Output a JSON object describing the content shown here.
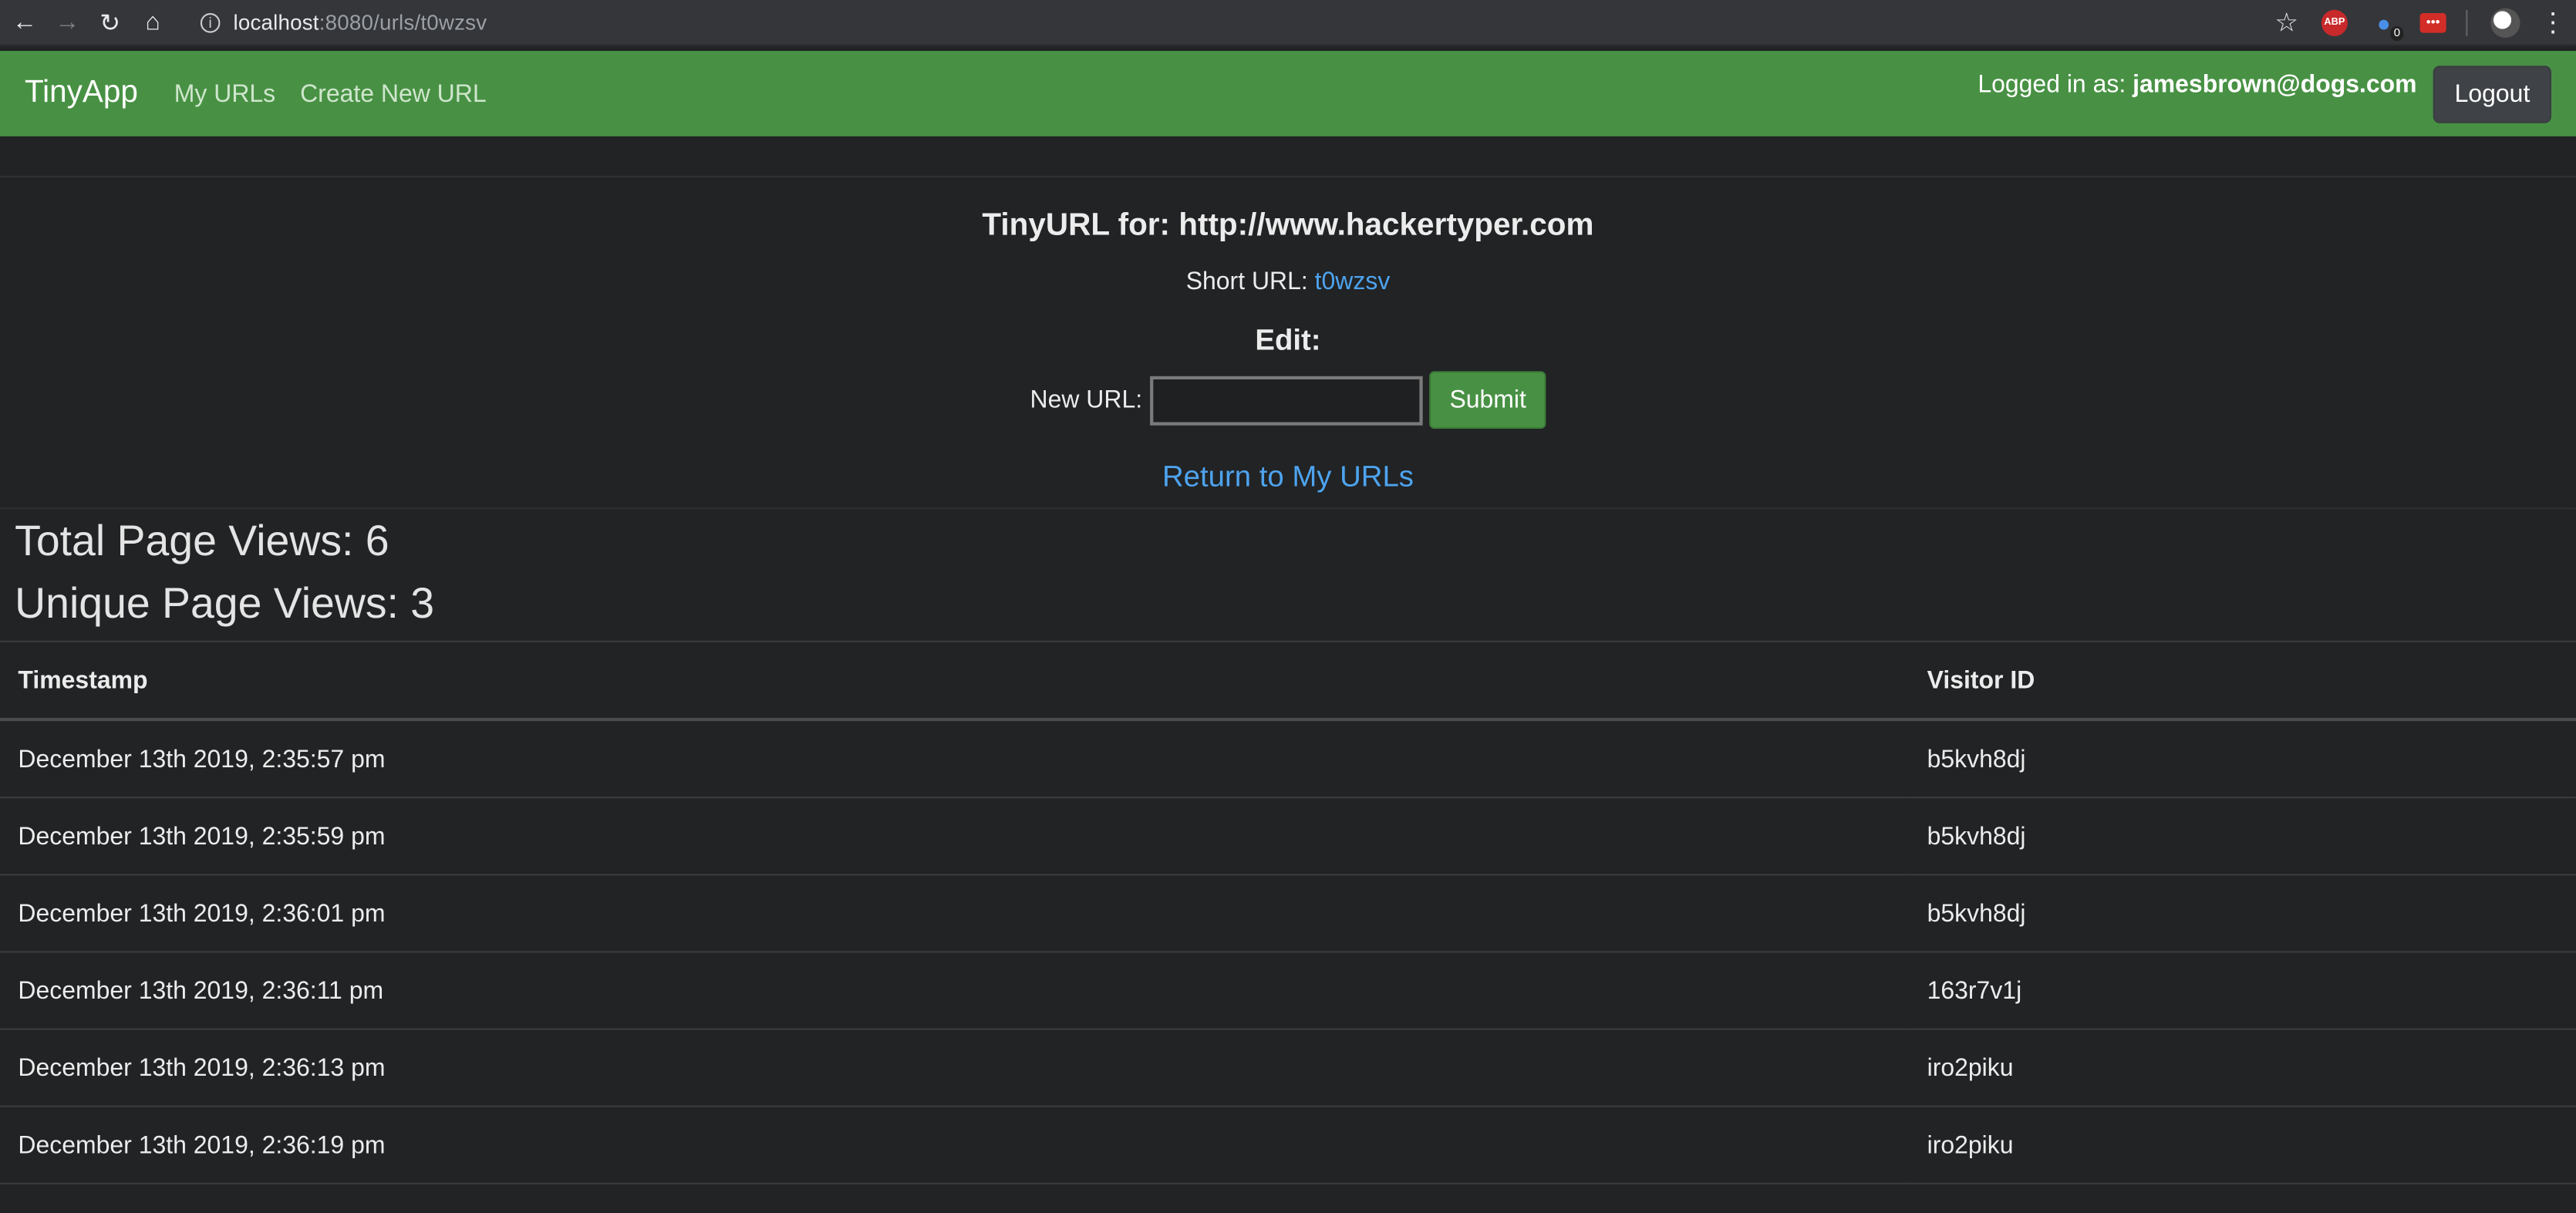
{
  "browser": {
    "url_host": "localhost",
    "url_rest": ":8080/urls/t0wzsv",
    "extensions": {
      "abp_label": "ABP",
      "ghostery_badge": "0",
      "lastpass_label": "•••"
    }
  },
  "navbar": {
    "brand": "TinyApp",
    "links": [
      "My URLs",
      "Create New URL"
    ],
    "logged_in_prefix": "Logged in as:",
    "logged_in_user": "jamesbrown@dogs.com",
    "logout_label": "Logout",
    "color": "#489144"
  },
  "url_detail": {
    "title": "TinyURL for: http://www.hackertyper.com",
    "short_url_label": "Short URL:",
    "short_url": "t0wzsv",
    "edit_heading": "Edit:",
    "new_url_label": "New URL:",
    "new_url_value": "",
    "submit_label": "Submit",
    "return_link": "Return to My URLs"
  },
  "stats": {
    "total_label": "Total Page Views: 6",
    "unique_label": "Unique Page Views: 3"
  },
  "visits_table": {
    "headers": [
      "Timestamp",
      "Visitor ID"
    ],
    "rows": [
      [
        "December 13th 2019, 2:35:57 pm",
        "b5kvh8dj"
      ],
      [
        "December 13th 2019, 2:35:59 pm",
        "b5kvh8dj"
      ],
      [
        "December 13th 2019, 2:36:01 pm",
        "b5kvh8dj"
      ],
      [
        "December 13th 2019, 2:36:11 pm",
        "163r7v1j"
      ],
      [
        "December 13th 2019, 2:36:13 pm",
        "iro2piku"
      ],
      [
        "December 13th 2019, 2:36:19 pm",
        "iro2piku"
      ]
    ]
  }
}
